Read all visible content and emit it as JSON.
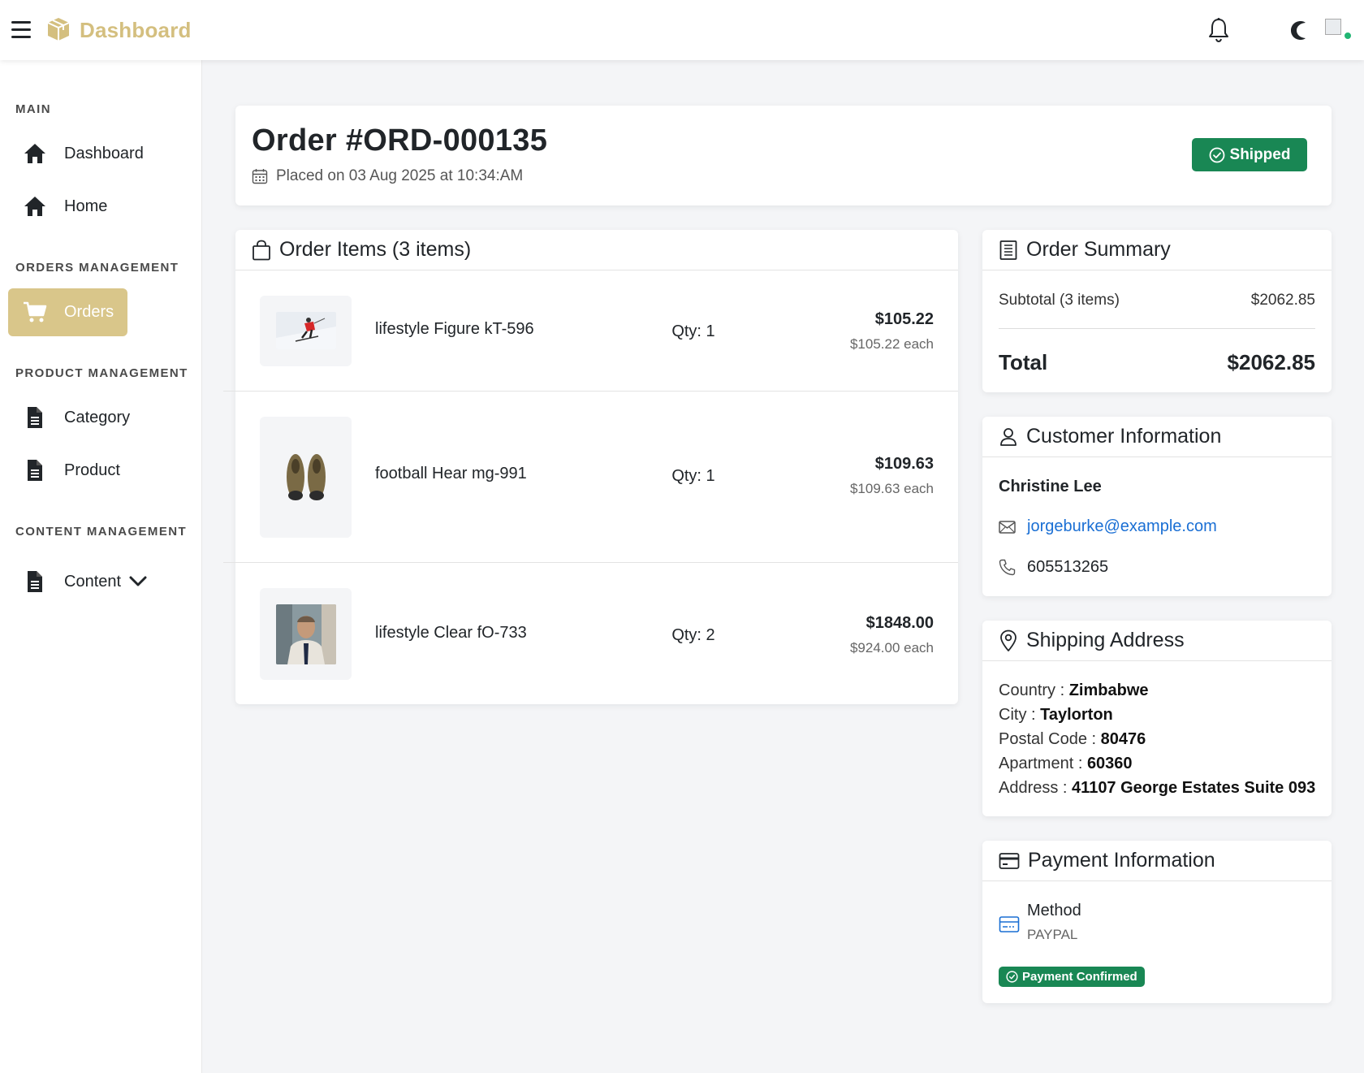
{
  "header": {
    "brand": "Dashboard",
    "brand_color": "#d4bf7f",
    "icons": [
      "hamburger-icon",
      "box-icon",
      "bell-icon",
      "moon-icon",
      "avatar"
    ]
  },
  "sidebar": {
    "sections": [
      {
        "title": "MAIN",
        "items": [
          {
            "label": "Dashboard",
            "icon": "home-icon"
          },
          {
            "label": "Home",
            "icon": "home-icon"
          }
        ]
      },
      {
        "title": "ORDERS MANAGEMENT",
        "items": [
          {
            "label": "Orders",
            "icon": "cart-icon",
            "active": true
          }
        ]
      },
      {
        "title": "PRODUCT MANAGEMENT",
        "items": [
          {
            "label": "Category",
            "icon": "file-icon"
          },
          {
            "label": "Product",
            "icon": "file-icon"
          }
        ]
      },
      {
        "title": "CONTENT MANAGEMENT",
        "items": [
          {
            "label": "Content",
            "icon": "file-icon",
            "has_dropdown": true
          }
        ]
      }
    ],
    "active_color": "#d9c68a"
  },
  "order": {
    "title": "Order #ORD-000135",
    "placed": "Placed on 03 Aug 2025 at 10:34:AM",
    "status": "Shipped",
    "status_color": "#198754"
  },
  "items_card": {
    "title": "Order Items (3 items)",
    "items": [
      {
        "name": "lifestyle Figure kT-596",
        "qty": "Qty: 1",
        "total": "$105.22",
        "each": "$105.22 each"
      },
      {
        "name": "football Hear mg-991",
        "qty": "Qty: 1",
        "total": "$109.63",
        "each": "$109.63 each"
      },
      {
        "name": "lifestyle Clear fO-733",
        "qty": "Qty: 2",
        "total": "$1848.00",
        "each": "$924.00 each"
      }
    ]
  },
  "summary": {
    "title": "Order Summary",
    "subtotal_label": "Subtotal (3 items)",
    "subtotal_value": "$2062.85",
    "total_label": "Total",
    "total_value": "$2062.85"
  },
  "customer": {
    "title": "Customer Information",
    "name": "Christine Lee",
    "email": "jorgeburke@example.com",
    "phone": "605513265"
  },
  "shipping": {
    "title": "Shipping Address",
    "lines": [
      {
        "label": "Country : ",
        "value": "Zimbabwe"
      },
      {
        "label": "City : ",
        "value": "Taylorton"
      },
      {
        "label": "Postal Code : ",
        "value": "80476"
      },
      {
        "label": "Apartment : ",
        "value": "60360"
      },
      {
        "label": "Address : ",
        "value": "41107 George Estates Suite 093"
      }
    ]
  },
  "payment": {
    "title": "Payment Information",
    "method_label": "Method",
    "method_value": "PAYPAL",
    "status": "Payment Confirmed"
  }
}
